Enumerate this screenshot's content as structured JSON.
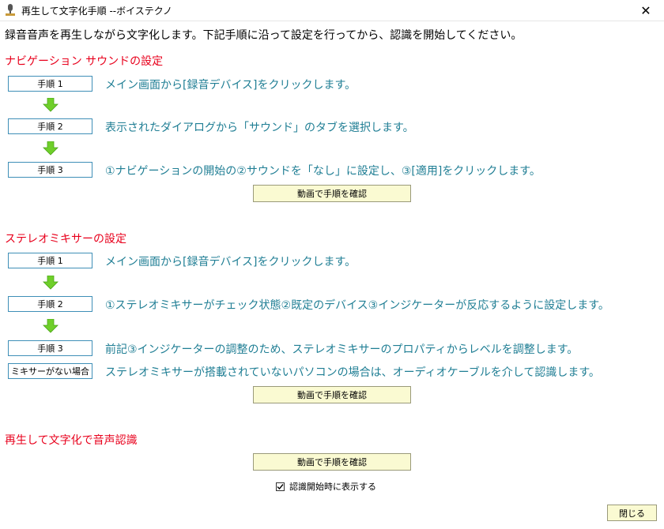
{
  "window": {
    "title": "再生して文字化手順 --ボイステクノ",
    "close_glyph": "✕"
  },
  "intro": "録音音声を再生しながら文字化します。下記手順に沿って設定を行ってから、認識を開始してください。",
  "sections": {
    "nav": {
      "heading": "ナビゲーション サウンドの設定",
      "steps": [
        {
          "label": "手順 1",
          "text": "メイン画面から[録音デバイス]をクリックします。"
        },
        {
          "label": "手順 2",
          "text": "表示されたダイアログから「サウンド」のタブを選択します。"
        },
        {
          "label": "手順 3",
          "text": "①ナビゲーションの開始の②サウンドを「なし」に設定し、③[適用]をクリックします。"
        }
      ],
      "video_button": "動画で手順を確認"
    },
    "stereo": {
      "heading": "ステレオミキサーの設定",
      "steps": [
        {
          "label": "手順 1",
          "text": "メイン画面から[録音デバイス]をクリックします。"
        },
        {
          "label": "手順 2",
          "text": "①ステレオミキサーがチェック状態②既定のデバイス③インジケーターが反応するように設定します。"
        },
        {
          "label": "手順 3",
          "text": "前記③インジケーターの調整のため、ステレオミキサーのプロパティからレベルを調整します。"
        },
        {
          "label": "ミキサーがない場合",
          "text": "ステレオミキサーが搭載されていないパソコンの場合は、オーディオケーブルを介して認識します。"
        }
      ],
      "video_button": "動画で手順を確認"
    },
    "recognize": {
      "heading": "再生して文字化で音声認識",
      "video_button": "動画で手順を確認"
    }
  },
  "footer": {
    "show_on_start_label": "認識開始時に表示する",
    "show_on_start_checked": true,
    "close_button": "閉じる"
  },
  "colors": {
    "heading": "#e8001c",
    "step_text": "#1f7e94",
    "step_border": "#3f8fb7",
    "button_bg": "#fafad2",
    "arrow": "#6fcf2a"
  }
}
